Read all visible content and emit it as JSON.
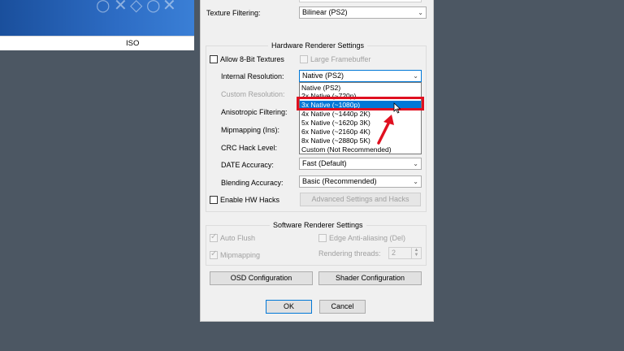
{
  "game_list": {
    "symbols": [
      "○",
      "✕",
      "◇",
      "○",
      "✕"
    ],
    "column_label": "ISO"
  },
  "dialog": {
    "texture_filtering": {
      "label": "Texture Filtering:",
      "value": "Bilinear (PS2)"
    },
    "hw_group": {
      "title": "Hardware Renderer Settings",
      "allow_8bit": "Allow 8-Bit Textures",
      "large_framebuffer": "Large Framebuffer",
      "internal_resolution": {
        "label": "Internal Resolution:",
        "value": "Native (PS2)"
      },
      "custom_resolution": {
        "label": "Custom Resolution:"
      },
      "anisotropic": {
        "label": "Anisotropic Filtering:"
      },
      "mipmapping": {
        "label": "Mipmapping (Ins):"
      },
      "crc_hack": {
        "label": "CRC Hack Level:"
      },
      "date_accuracy": {
        "label": "DATE Accuracy:",
        "value": "Fast (Default)"
      },
      "blending_accuracy": {
        "label": "Blending Accuracy:",
        "value": "Basic (Recommended)"
      },
      "enable_hw_hacks": "Enable HW Hacks",
      "advanced_button": "Advanced Settings and Hacks"
    },
    "resolution_options": [
      "Native (PS2)",
      "2x Native (~720p)",
      "3x Native (~1080p)",
      "4x Native (~1440p 2K)",
      "5x Native (~1620p 3K)",
      "6x Native (~2160p 4K)",
      "8x Native (~2880p 5K)",
      "Custom (Not Recommended)"
    ],
    "selected_option_index": 2,
    "sw_group": {
      "title": "Software Renderer Settings",
      "auto_flush": "Auto Flush",
      "edge_aa": "Edge Anti-aliasing (Del)",
      "mipmapping": "Mipmapping",
      "rendering_threads": {
        "label": "Rendering threads:",
        "value": "2"
      }
    },
    "osd_button": "OSD Configuration",
    "shader_button": "Shader Configuration",
    "ok_button": "OK",
    "cancel_button": "Cancel"
  },
  "colors": {
    "highlight_box": "#e01020",
    "selection": "#0078d7",
    "desktop": "#4c5763"
  }
}
